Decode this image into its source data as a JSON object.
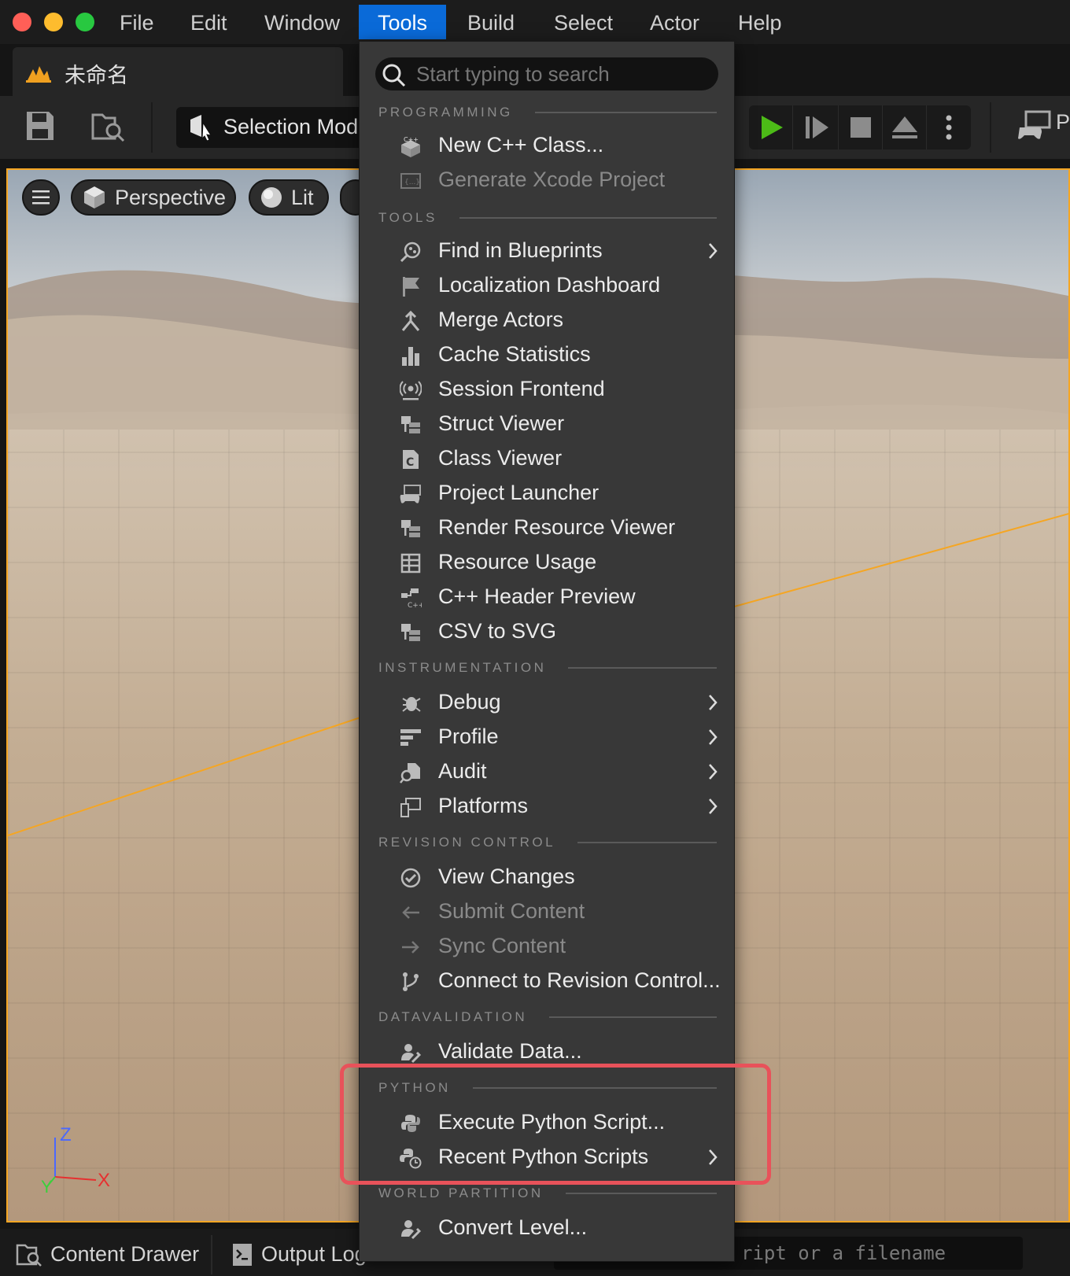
{
  "menubar": {
    "items": [
      "File",
      "Edit",
      "Window",
      "Tools",
      "Build",
      "Select",
      "Actor",
      "Help"
    ],
    "active": "Tools"
  },
  "tab": {
    "title": "未命名"
  },
  "toolbar": {
    "selection_mode": "Selection Mode",
    "platforms_label": "P"
  },
  "viewport": {
    "perspective": "Perspective",
    "lit": "Lit",
    "axis": {
      "z": "Z",
      "x": "X",
      "y": "Y"
    }
  },
  "bottombar": {
    "content_drawer": "Content Drawer",
    "output_log": "Output Log",
    "cmd_placeholder": "ript or a filename"
  },
  "dropdown": {
    "search_placeholder": "Start typing to search",
    "sections": {
      "programming": "PROGRAMMING",
      "tools": "TOOLS",
      "instrumentation": "INSTRUMENTATION",
      "revision_control": "REVISION CONTROL",
      "datavalidation": "DATAVALIDATION",
      "python": "PYTHON",
      "world_partition": "WORLD PARTITION"
    },
    "items": {
      "new_cpp_class": "New C++ Class...",
      "generate_xcode": "Generate Xcode Project",
      "find_in_blueprints": "Find in Blueprints",
      "localization_dashboard": "Localization Dashboard",
      "merge_actors": "Merge Actors",
      "cache_statistics": "Cache Statistics",
      "session_frontend": "Session Frontend",
      "struct_viewer": "Struct Viewer",
      "class_viewer": "Class Viewer",
      "project_launcher": "Project Launcher",
      "render_resource_viewer": "Render Resource Viewer",
      "resource_usage": "Resource Usage",
      "cpp_header_preview": "C++ Header Preview",
      "csv_to_svg": "CSV to SVG",
      "debug": "Debug",
      "profile": "Profile",
      "audit": "Audit",
      "platforms": "Platforms",
      "view_changes": "View Changes",
      "submit_content": "Submit Content",
      "sync_content": "Sync Content",
      "connect_revision_control": "Connect to Revision Control...",
      "validate_data": "Validate Data...",
      "execute_python_script": "Execute Python Script...",
      "recent_python_scripts": "Recent Python Scripts",
      "convert_level": "Convert Level..."
    }
  },
  "colors": {
    "menu_active": "#0a6ad8",
    "highlight_box": "#e8525a",
    "play_green": "#4cbb17",
    "selection_outline": "#f5a623"
  }
}
